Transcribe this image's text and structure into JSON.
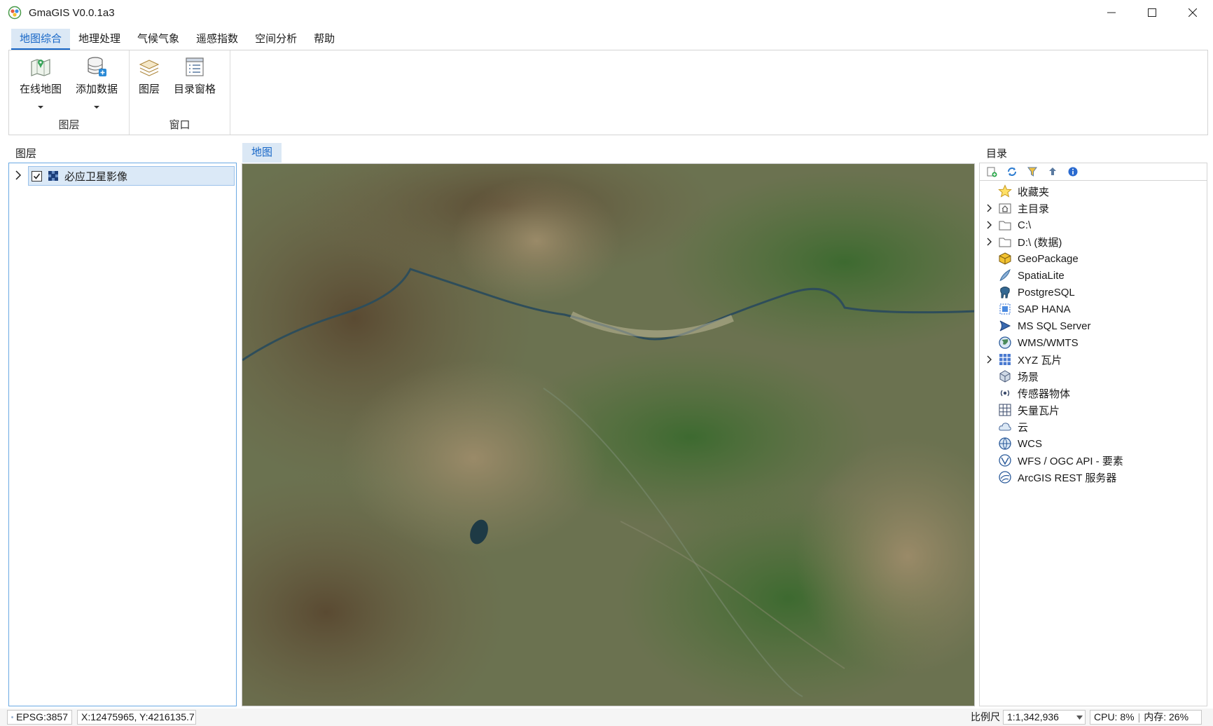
{
  "window": {
    "title": "GmaGIS V0.0.1a3"
  },
  "menu_tabs": [
    "地图综合",
    "地理处理",
    "气候气象",
    "遥感指数",
    "空间分析",
    "帮助"
  ],
  "ribbon": {
    "online_map": "在线地图",
    "add_data": "添加数据",
    "layers_group": "图层",
    "layer_btn": "图层",
    "catalog_pane": "目录窗格",
    "window_group": "窗口"
  },
  "layers": {
    "title": "图层",
    "items": [
      {
        "name": "必应卫星影像",
        "checked": true
      }
    ]
  },
  "map": {
    "tab_label": "地图"
  },
  "catalog": {
    "title": "目录",
    "items": [
      {
        "label": "收藏夹",
        "icon": "star-icon",
        "expandable": false
      },
      {
        "label": "主目录",
        "icon": "home-icon",
        "expandable": true
      },
      {
        "label": "C:\\",
        "icon": "folder-icon",
        "expandable": true
      },
      {
        "label": "D:\\ (数据)",
        "icon": "folder-icon",
        "expandable": true
      },
      {
        "label": "GeoPackage",
        "icon": "geopackage-icon",
        "expandable": false
      },
      {
        "label": "SpatiaLite",
        "icon": "feather-icon",
        "expandable": false
      },
      {
        "label": "PostgreSQL",
        "icon": "elephant-icon",
        "expandable": false
      },
      {
        "label": "SAP HANA",
        "icon": "hana-icon",
        "expandable": false
      },
      {
        "label": "MS SQL Server",
        "icon": "sqlserver-icon",
        "expandable": false
      },
      {
        "label": "WMS/WMTS",
        "icon": "globe-icon",
        "expandable": false
      },
      {
        "label": "XYZ 瓦片",
        "icon": "grid-icon",
        "expandable": true
      },
      {
        "label": "场景",
        "icon": "cube-icon",
        "expandable": false
      },
      {
        "label": "传感器物体",
        "icon": "sensor-icon",
        "expandable": false
      },
      {
        "label": "矢量瓦片",
        "icon": "vector-tiles-icon",
        "expandable": false
      },
      {
        "label": "云",
        "icon": "cloud-icon",
        "expandable": false
      },
      {
        "label": "WCS",
        "icon": "globe-icon",
        "expandable": false
      },
      {
        "label": "WFS / OGC API - 要素",
        "icon": "wfs-icon",
        "expandable": false
      },
      {
        "label": "ArcGIS REST 服务器",
        "icon": "arcgis-icon",
        "expandable": false
      }
    ]
  },
  "status": {
    "crs": "EPSG:3857",
    "coords": "X:12475965, Y:4216135.7",
    "scale_label": "比例尺",
    "scale_value": "1:1,342,936",
    "cpu": "CPU:  8%",
    "memory": "内存: 26%"
  },
  "colors": {
    "accent": "#1666c7",
    "tab_bg": "#dbe8f5",
    "selection": "#dbe9f7"
  }
}
